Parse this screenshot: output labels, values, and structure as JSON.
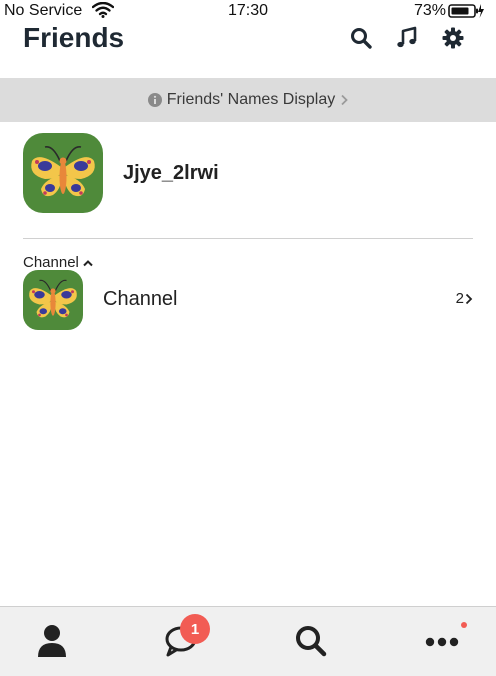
{
  "status_bar": {
    "carrier": "No Service",
    "time": "17:30",
    "battery_percent": "73%"
  },
  "header": {
    "title": "Friends",
    "icons": [
      "search-icon",
      "music-note-icon",
      "gear-icon"
    ]
  },
  "info_bar": {
    "label": "Friends' Names Display"
  },
  "profile": {
    "name": "Jjye_2lrwi",
    "avatar": "butterfly-avatar"
  },
  "channels_section": {
    "header": "Channel",
    "items": [
      {
        "label": "Channel",
        "count": "2",
        "avatar": "butterfly-avatar"
      }
    ]
  },
  "tab_bar": {
    "tabs": [
      "person-icon",
      "chat-bubble-icon",
      "search-icon",
      "more-icon"
    ],
    "chat_badge": "1"
  },
  "colors": {
    "accent": "#f25c54",
    "avatar_bg": "#4f8a3a",
    "info_bar_bg": "#dcdcdc",
    "tab_bar_bg": "#f0f0f0"
  }
}
